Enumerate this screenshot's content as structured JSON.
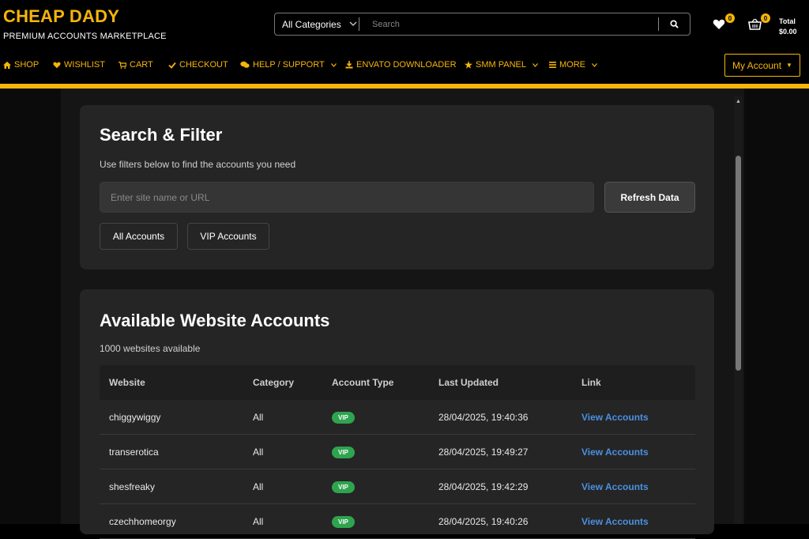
{
  "header": {
    "brand_title": "CHEAP DADY",
    "brand_subtitle": "PREMIUM ACCOUNTS MARKETPLACE",
    "search": {
      "category": "All Categories",
      "placeholder": "Search",
      "value": ""
    },
    "wishlist_count": "0",
    "cart_count": "0",
    "total_label": "Total",
    "total_value": "$0.00"
  },
  "nav": {
    "items": [
      {
        "label": "SHOP",
        "icon": "home-icon"
      },
      {
        "label": "WISHLIST",
        "icon": "heart-icon"
      },
      {
        "label": "CART",
        "icon": "cart-icon"
      },
      {
        "label": "CHECKOUT",
        "icon": "check-icon"
      },
      {
        "label": "HELP / SUPPORT",
        "icon": "chat-icon"
      },
      {
        "label": "ENVATO DOWNLOADER",
        "icon": "download-icon"
      },
      {
        "label": "SMM PANEL",
        "icon": "star-icon"
      },
      {
        "label": "MORE",
        "icon": "bars-icon"
      }
    ],
    "my_account": "My Account"
  },
  "filter_card": {
    "title": "Search & Filter",
    "subtitle": "Use filters below to find the accounts you need",
    "input_placeholder": "Enter site name or URL",
    "refresh_label": "Refresh Data",
    "all_accounts_label": "All Accounts",
    "vip_accounts_label": "VIP Accounts"
  },
  "accounts_card": {
    "title": "Available Website Accounts",
    "count_text": "1000 websites available",
    "columns": [
      "Website",
      "Category",
      "Account Type",
      "Last Updated",
      "Link"
    ],
    "rows": [
      {
        "website": "chiggywiggy",
        "category": "All",
        "type": "VIP",
        "updated": "28/04/2025, 19:40:36",
        "link": "View Accounts"
      },
      {
        "website": "transerotica",
        "category": "All",
        "type": "VIP",
        "updated": "28/04/2025, 19:49:27",
        "link": "View Accounts"
      },
      {
        "website": "shesfreaky",
        "category": "All",
        "type": "VIP",
        "updated": "28/04/2025, 19:42:29",
        "link": "View Accounts"
      },
      {
        "website": "czechhomeorgy",
        "category": "All",
        "type": "VIP",
        "updated": "28/04/2025, 19:40:26",
        "link": "View Accounts"
      }
    ]
  },
  "colors": {
    "accent": "#f5b50a",
    "vip_badge": "#2ea44f",
    "link": "#4a90e2",
    "card": "#252525"
  }
}
